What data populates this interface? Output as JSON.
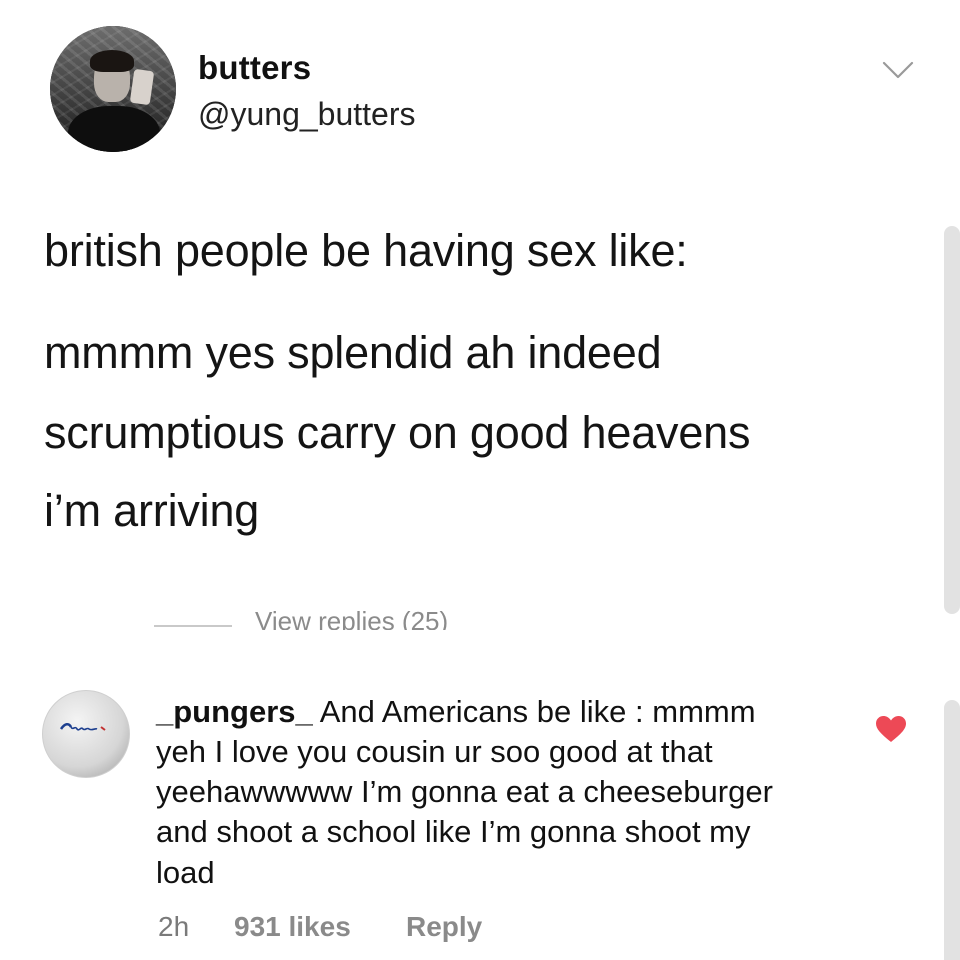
{
  "tweet": {
    "display_name": "butters",
    "handle": "@yung_butters",
    "lines": [
      "british people be having sex like:",
      "mmmm yes splendid ah indeed",
      "scrumptious carry on good heavens",
      "i’m arriving"
    ]
  },
  "replies": {
    "view_label": "View replies (25)"
  },
  "comment": {
    "username": "_pungers_",
    "lines": [
      "And Americans be like : mmmm",
      "yeh I love you cousin ur soo good at that",
      "yeehawwwww I’m gonna eat a cheeseburger",
      "and shoot a school like I’m gonna shoot my",
      "load"
    ],
    "time": "2h",
    "likes": "931 likes",
    "reply_label": "Reply",
    "liked": true,
    "heart_color": "#ed4956"
  },
  "icons": {
    "menu": "chevron-down-icon",
    "like": "heart-icon"
  }
}
